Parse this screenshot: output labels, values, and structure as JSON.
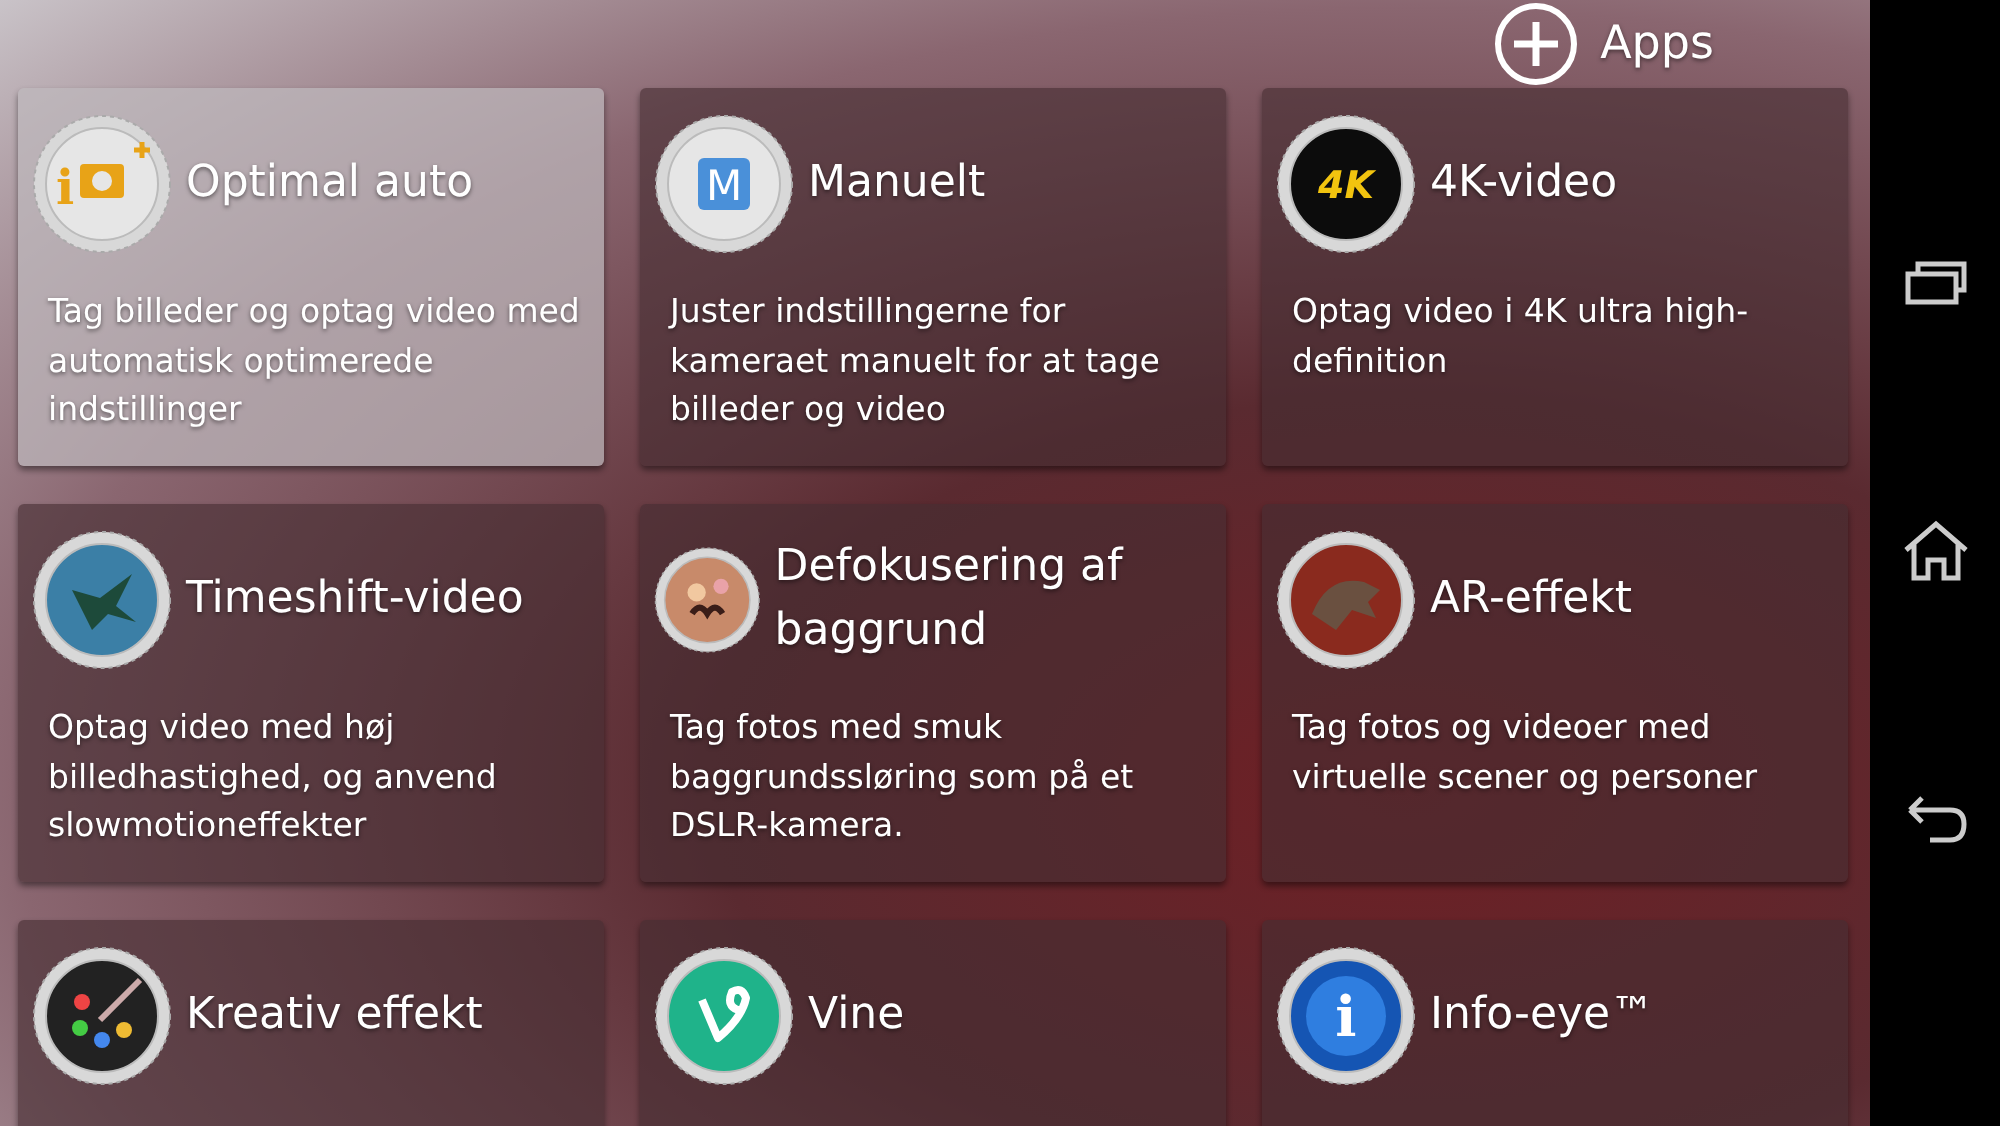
{
  "header": {
    "apps_label": "Apps"
  },
  "modes": [
    {
      "title": "Optimal auto",
      "description": "Tag billeder og optag video med automatisk optimerede indstillinger",
      "icon_text": "i",
      "selected": true
    },
    {
      "title": "Manuelt",
      "description": "Juster indstillingerne for kameraet manuelt for at tage billeder og video",
      "icon_text": "M",
      "selected": false
    },
    {
      "title": "4K-video",
      "description": "Optag video i 4K ultra high-definition",
      "icon_text": "4K",
      "selected": false
    },
    {
      "title": "Timeshift-video",
      "description": "Optag video med høj billedhastighed, og anvend slowmotioneffekter",
      "selected": false
    },
    {
      "title": "Defokusering af baggrund",
      "description": "Tag fotos med smuk baggrundssløring som på et DSLR-kamera.",
      "selected": false
    },
    {
      "title": "AR-effekt",
      "description": "Tag fotos og videoer med virtuelle scener og personer",
      "selected": false
    },
    {
      "title": "Kreativ effekt",
      "selected": false
    },
    {
      "title": "Vine",
      "selected": false
    },
    {
      "title": "Info-eye™",
      "icon_text": "i",
      "selected": false
    }
  ]
}
